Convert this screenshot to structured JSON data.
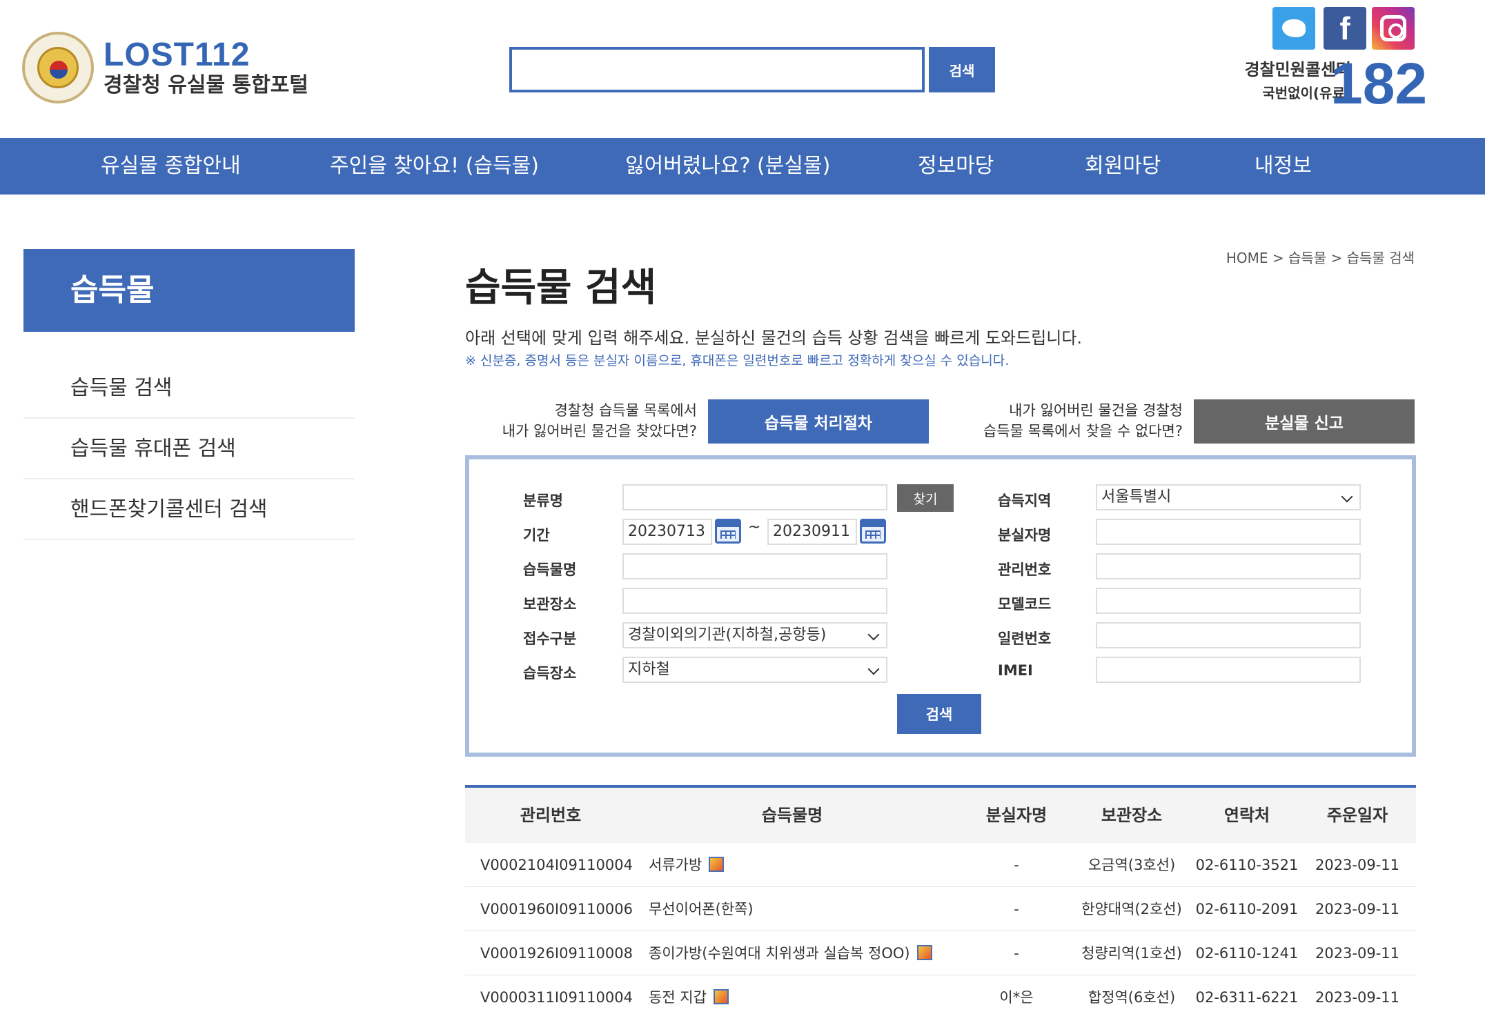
{
  "header": {
    "logo_title": "LOST112",
    "logo_subtitle": "경찰청 유실물 통합포털",
    "search_value": "",
    "search_button": "검색",
    "social": [
      "twitter-icon",
      "facebook-icon",
      "instagram-icon"
    ],
    "call_center_title": "경찰민원콜센터",
    "call_center_sub": "국번없이(유료)",
    "call_center_number": "182"
  },
  "nav": [
    "유실물 종합안내",
    "주인을 찾아요! (습득물)",
    "잃어버렸나요? (분실물)",
    "정보마당",
    "회원마당",
    "내정보"
  ],
  "sidebar": {
    "title": "습득물",
    "items": [
      "습득물 검색",
      "습득물 휴대폰 검색",
      "핸드폰찾기콜센터 검색"
    ]
  },
  "main": {
    "breadcrumb": "HOME > 습득물 > 습득물 검색",
    "title": "습득물 검색",
    "description": "아래 선택에 맞게 입력 해주세요. 분실하신 물건의 습득 상황 검색을 빠르게 도와드립니다.",
    "note": "※ 신분증, 증명서 등은 분실자 이름으로, 휴대폰은 일련번호로 빠르고 정확하게 찾으실 수 있습니다.",
    "procedure_question_1": "경찰청 습득물 목록에서",
    "procedure_question_2": "내가 잃어버린 물건을 찾았다면?",
    "procedure_button": "습득물 처리절차",
    "report_question_1": "내가 잃어버린 물건을 경찰청",
    "report_question_2": "습득물 목록에서 찾을 수 없다면?",
    "report_button": "분실물 신고"
  },
  "form": {
    "category_label": "분류명",
    "category_value": "",
    "find_button": "찾기",
    "period_label": "기간",
    "date_from": "20230713",
    "date_to": "20230911",
    "tilde": "~",
    "item_name_label": "습득물명",
    "item_name_value": "",
    "storage_label": "보관장소",
    "storage_value": "",
    "receipt_type_label": "접수구분",
    "receipt_type_value": "경찰이외의기관(지하철,공항등)",
    "found_place_label": "습득장소",
    "found_place_value": "지하철",
    "found_region_label": "습득지역",
    "found_region_value": "서울특별시",
    "owner_name_label": "분실자명",
    "owner_name_value": "",
    "management_no_label": "관리번호",
    "management_no_value": "",
    "model_code_label": "모델코드",
    "model_code_value": "",
    "serial_no_label": "일련번호",
    "serial_no_value": "",
    "imei_label": "IMEI",
    "imei_value": "",
    "search_button": "검색"
  },
  "table": {
    "headers": [
      "관리번호",
      "습득물명",
      "분실자명",
      "보관장소",
      "연락처",
      "주운일자"
    ],
    "rows": [
      {
        "id": "V0002104I09110004",
        "item": "서류가방",
        "has_image": true,
        "owner": "-",
        "storage": "오금역(3호선)",
        "phone": "02-6110-3521",
        "date": "2023-09-11"
      },
      {
        "id": "V0001960I09110006",
        "item": "무선이어폰(한쪽)",
        "has_image": false,
        "owner": "-",
        "storage": "한양대역(2호선)",
        "phone": "02-6110-2091",
        "date": "2023-09-11"
      },
      {
        "id": "V0001926I09110008",
        "item": "종이가방(수원여대 치위생과 실습복 정OO)",
        "has_image": true,
        "owner": "-",
        "storage": "청량리역(1호선)",
        "phone": "02-6110-1241",
        "date": "2023-09-11"
      },
      {
        "id": "V0000311I09110004",
        "item": "동전 지갑",
        "has_image": true,
        "owner": "이*은",
        "storage": "합정역(6호선)",
        "phone": "02-6311-6221",
        "date": "2023-09-11"
      }
    ]
  },
  "colors": {
    "brand_blue": "#3f6ab8",
    "report_gray": "#666666",
    "panel_border": "#a9bede"
  }
}
